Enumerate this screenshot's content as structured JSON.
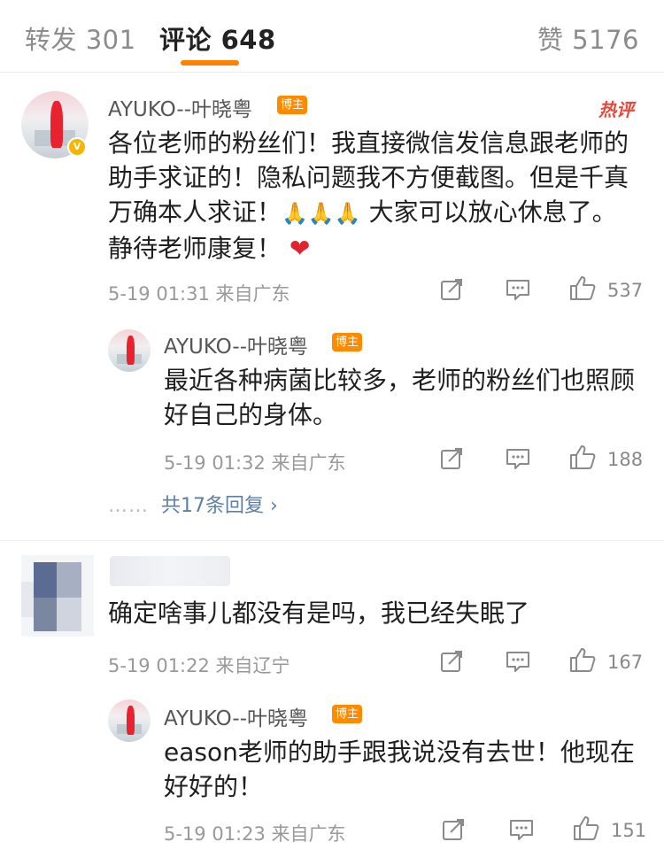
{
  "tabs": {
    "repost": "转发 301",
    "comments": "评论 648",
    "likes": "赞 5176"
  },
  "colors": {
    "accent": "#ff8200",
    "badge": "#ff8a00",
    "hot": "#e8483a",
    "link": "#5d7fa8"
  },
  "comments": [
    {
      "author": "AYUKO--叶晓粤",
      "badge": "博主",
      "hot_label": "热评",
      "text_a": "各位老师的粉丝们！我直接微信发信息跟老师的助手求证的！隐私问题我不方便截图。但是千真万确本人求证！",
      "text_emoji": "🙏🙏🙏",
      "text_b": " 大家可以放心休息了。静待老师康复！",
      "text_heart": "❤",
      "time": "5-19 01:31 来自广东",
      "likes": "537",
      "reply": {
        "author": "AYUKO--叶晓粤",
        "badge": "博主",
        "text": "最近各种病菌比较多，老师的粉丝们也照顾好自己的身体。",
        "time": "5-19 01:32 来自广东",
        "likes": "188"
      },
      "more_replies": "共17条回复 ›",
      "more_dots": "……"
    },
    {
      "text": "确定啥事儿都没有是吗，我已经失眠了",
      "time": "5-19 01:22 来自辽宁",
      "likes": "167",
      "reply": {
        "author": "AYUKO--叶晓粤",
        "badge": "博主",
        "text": "eason老师的助手跟我说没有去世！他现在好好的！",
        "time": "5-19 01:23 来自广东",
        "likes": "151"
      }
    }
  ],
  "icons": [
    "repost-icon",
    "comment-icon",
    "like-icon",
    "verified-icon"
  ]
}
